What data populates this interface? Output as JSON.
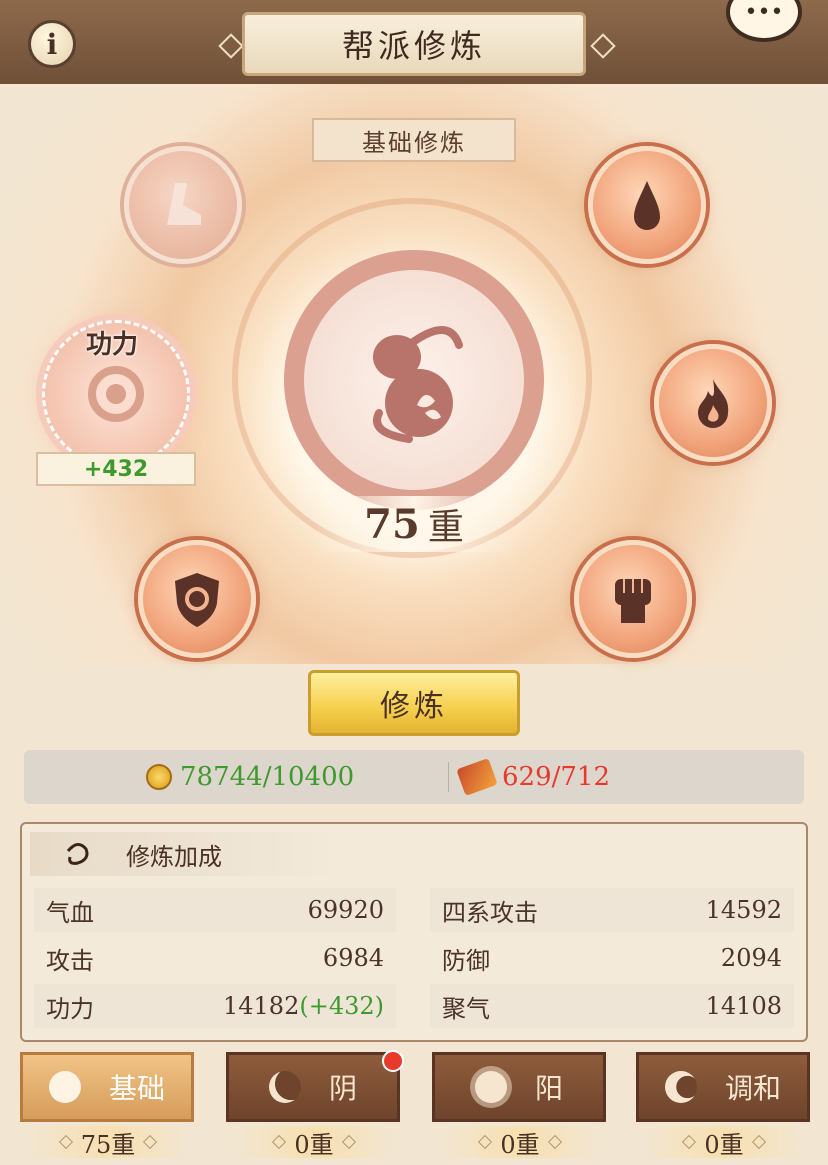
{
  "header": {
    "title": "帮派修炼",
    "info_icon": "i"
  },
  "stage": {
    "sub_title": "基础修炼",
    "level_value": "75",
    "level_unit": "重",
    "selected_node_label": "功力",
    "selected_node_bonus": "+432",
    "nodes": [
      {
        "name": "speed-node",
        "icon": "boot-icon"
      },
      {
        "name": "blood-node",
        "icon": "drop-icon"
      },
      {
        "name": "gongli-node",
        "icon": "swirl-icon"
      },
      {
        "name": "fire-node",
        "icon": "flame-icon"
      },
      {
        "name": "defense-node",
        "icon": "shield-icon"
      },
      {
        "name": "attack-node",
        "icon": "fist-icon"
      }
    ]
  },
  "actions": {
    "cultivate_label": "修炼"
  },
  "resources": {
    "coin": "78744/10400",
    "scroll": "629/712",
    "coin_color": "#3f9a2e",
    "scroll_color": "#e8392a"
  },
  "stats": {
    "header": "修炼加成",
    "rows_left": [
      {
        "label": "气血",
        "value": "69920"
      },
      {
        "label": "攻击",
        "value": "6984"
      },
      {
        "label": "功力",
        "value": "14182",
        "bonus": "(+432)"
      }
    ],
    "rows_right": [
      {
        "label": "四系攻击",
        "value": "14592"
      },
      {
        "label": "防御",
        "value": "2094"
      },
      {
        "label": "聚气",
        "value": "14108"
      }
    ]
  },
  "tabs": [
    {
      "label": "基础",
      "level": "75重"
    },
    {
      "label": "阴",
      "level": "0重"
    },
    {
      "label": "阳",
      "level": "0重"
    },
    {
      "label": "调和",
      "level": "0重"
    }
  ]
}
